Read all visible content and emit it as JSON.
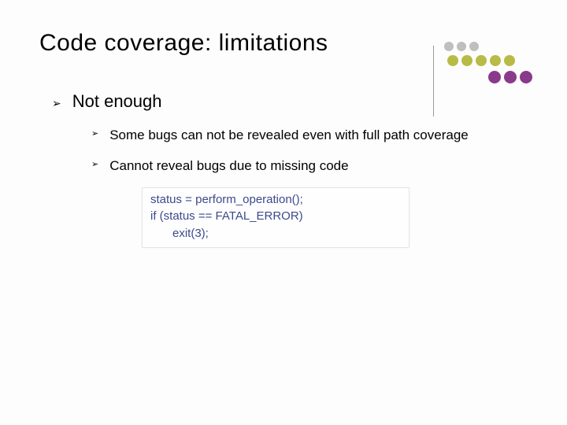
{
  "title": "Code coverage: limitations",
  "bullet_glyph": "➢",
  "lvl1": {
    "text": "Not enough"
  },
  "lvl2": [
    {
      "text": "Some bugs can not be revealed even with full path coverage"
    },
    {
      "text": "Cannot reveal bugs due to missing code"
    }
  ],
  "code": {
    "line1": "status = perform_operation();",
    "line2": "if (status == FATAL_ERROR)",
    "line3": "exit(3);"
  },
  "deco_colors": {
    "gray": "#bfbfbf",
    "olive": "#b8bb46",
    "purple": "#8a3a8a"
  }
}
